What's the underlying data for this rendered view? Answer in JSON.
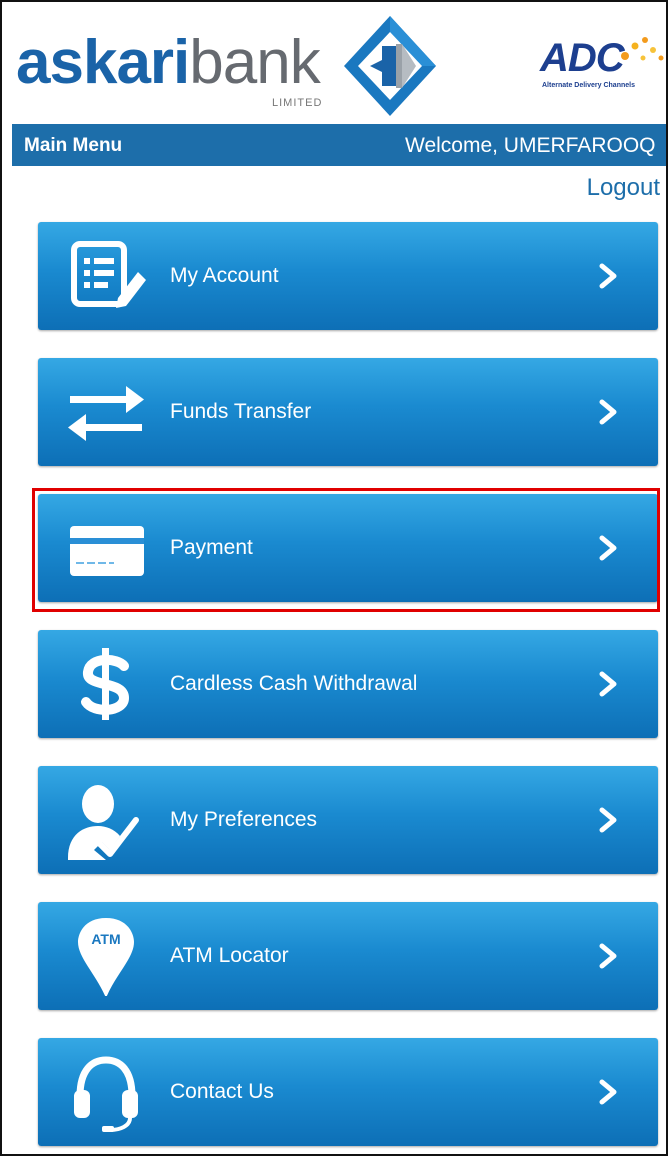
{
  "header": {
    "brand_part1": "askari",
    "brand_part2": "bank",
    "brand_sub": "LIMITED",
    "adc_logo": "ADC",
    "adc_tagline": "Alternate Delivery Channels"
  },
  "menubar": {
    "title": "Main Menu",
    "welcome": "Welcome, UMERFAROOQ"
  },
  "logout_label": "Logout",
  "menu": [
    {
      "label": "My Account",
      "icon": "account-statement-icon"
    },
    {
      "label": "Funds Transfer",
      "icon": "transfer-arrows-icon"
    },
    {
      "label": "Payment",
      "icon": "credit-card-icon"
    },
    {
      "label": "Cardless Cash Withdrawal",
      "icon": "dollar-icon"
    },
    {
      "label": "My Preferences",
      "icon": "user-check-icon"
    },
    {
      "label": "ATM Locator",
      "icon": "atm-pin-icon",
      "icon_text": "ATM"
    },
    {
      "label": "Contact Us",
      "icon": "headset-icon"
    }
  ],
  "highlighted_item": "Payment",
  "colors": {
    "brand_blue": "#1a63a8",
    "menubar": "#1d6eaa",
    "button_top": "#35a8e4",
    "button_bottom": "#0d6fb6",
    "highlight": "#e00000"
  }
}
